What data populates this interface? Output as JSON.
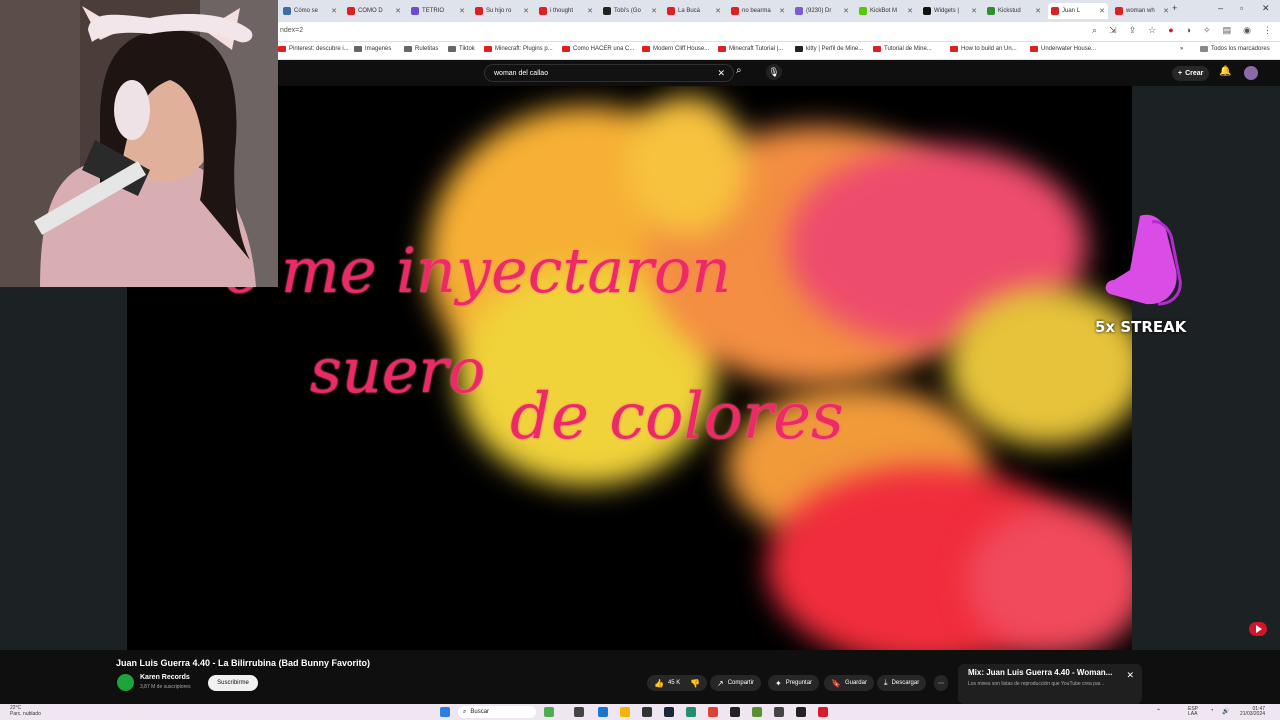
{
  "browser": {
    "tabs": [
      {
        "label": "Cómo se",
        "color": "#3a6ea5"
      },
      {
        "label": "COMO D",
        "color": "#e02020"
      },
      {
        "label": "TETRIO",
        "color": "#6b4bd8"
      },
      {
        "label": "Su hijo ro",
        "color": "#e02020"
      },
      {
        "label": "i thought",
        "color": "#e02020"
      },
      {
        "label": "Tobi's (Go",
        "color": "#222222"
      },
      {
        "label": "La Bucá",
        "color": "#e02020"
      },
      {
        "label": "no bearma",
        "color": "#e02020"
      },
      {
        "label": "(9230) Dr",
        "color": "#7c5bd6"
      },
      {
        "label": "KickBot M",
        "color": "#54c800"
      },
      {
        "label": "Widgets |",
        "color": "#111111"
      },
      {
        "label": "Kickstud",
        "color": "#2f8f2f"
      },
      {
        "label": "Juan L",
        "color": "#e02020"
      },
      {
        "label": "woman wh",
        "color": "#e02020"
      }
    ],
    "url": "ndex=2",
    "bookmarks": [
      {
        "label": "Pinterest: descubre i...",
        "color": "#e02020"
      },
      {
        "label": "Imagenes",
        "color": "#666666"
      },
      {
        "label": "Ruletitas",
        "color": "#666666"
      },
      {
        "label": "Tiktok",
        "color": "#666666"
      },
      {
        "label": "Minecraft: Plugins p...",
        "color": "#e02020"
      },
      {
        "label": "Como HACER una C...",
        "color": "#e02020"
      },
      {
        "label": "Modern Cliff House...",
        "color": "#e02020"
      },
      {
        "label": "Minecraft Tutorial |...",
        "color": "#e02020"
      },
      {
        "label": "kitty | Perfil de Mine...",
        "color": "#222222"
      },
      {
        "label": "Tutorial de Mine...",
        "color": "#e02020"
      },
      {
        "label": "How to build an Un...",
        "color": "#e02020"
      },
      {
        "label": "Underwater House...",
        "color": "#e02020"
      }
    ],
    "all_bookmarks": "Todos los marcadores"
  },
  "youtube": {
    "search_value": "woman del callao",
    "create_label": "Crear",
    "video": {
      "lyric_line1": "o me inyectaron",
      "lyric_line2": "suero",
      "lyric_line3": "de colores"
    },
    "overlay": {
      "streak_label": "5x STREAK"
    },
    "title": "Juan Luis Guerra 4.40 - La Bilirrubina (Bad Bunny Favorito)",
    "channel": {
      "name": "Karen Records",
      "subscribers": "3,87 M de suscriptores",
      "subscribe_label": "Suscribirme"
    },
    "actions": {
      "likes": "45 K",
      "share": "Compartir",
      "ask": "Preguntar",
      "save": "Guardar",
      "download": "Descargar"
    },
    "mix": {
      "title": "Mix: Juan Luis Guerra 4.40 - Woman...",
      "subtitle": "Los mixes son listas de reproducción que YouTube crea par..."
    }
  },
  "taskbar": {
    "weather_temp": "22°C",
    "weather_desc": "Parc. nublado",
    "search_placeholder": "Buscar",
    "lang": "ESP",
    "lang2": "LAA",
    "time": "01:47",
    "date": "21/03/2024"
  },
  "colors": {
    "accent": "#ff0000",
    "lyric": "#ee2a66",
    "streak_hand": "#d94ce6"
  }
}
